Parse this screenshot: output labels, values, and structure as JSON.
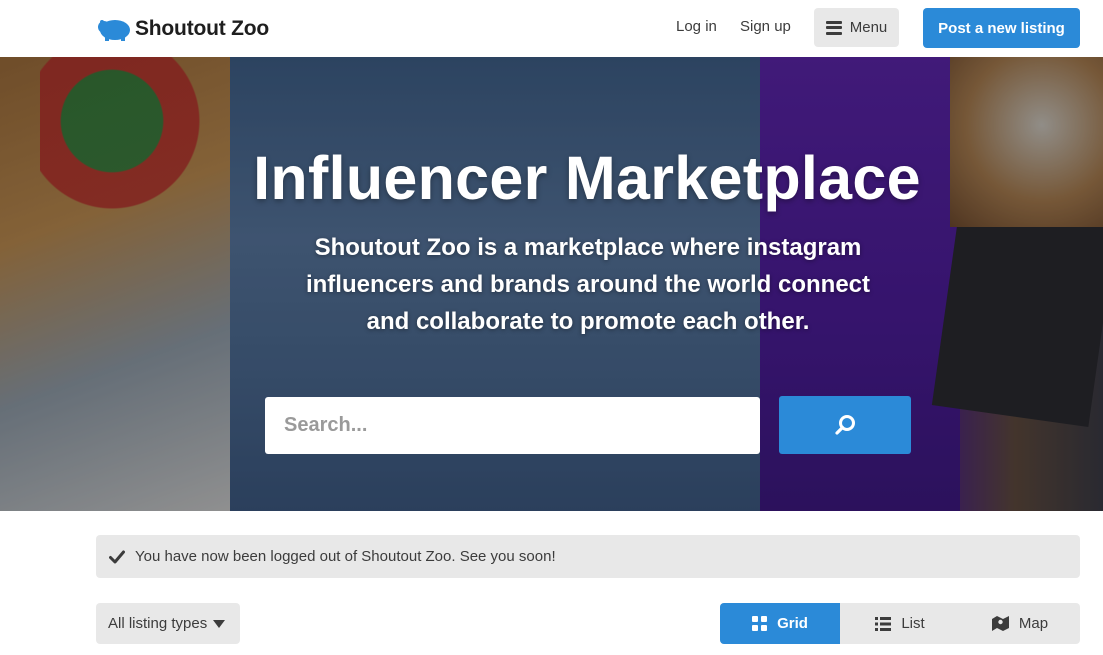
{
  "header": {
    "logo_text": "Shoutout Zoo",
    "login_label": "Log in",
    "signup_label": "Sign up",
    "menu_label": "Menu",
    "post_label": "Post a new listing"
  },
  "hero": {
    "title": "Influencer Marketplace",
    "subtitle": "Shoutout Zoo is a marketplace where instagram influencers and brands around the world connect and collaborate to promote each other.",
    "search_placeholder": "Search..."
  },
  "notice": {
    "text": "You have now been logged out of Shoutout Zoo. See you soon!"
  },
  "filters": {
    "listing_types_label": "All listing types",
    "views": [
      {
        "label": "Grid",
        "icon": "grid-icon",
        "active": true
      },
      {
        "label": "List",
        "icon": "list-icon",
        "active": false
      },
      {
        "label": "Map",
        "icon": "map-icon",
        "active": false
      }
    ]
  },
  "colors": {
    "accent": "#2b8ad8",
    "button_gray": "#e8e8e8",
    "text": "#3c3c3c",
    "logo_blue": "#2b8ad8"
  }
}
